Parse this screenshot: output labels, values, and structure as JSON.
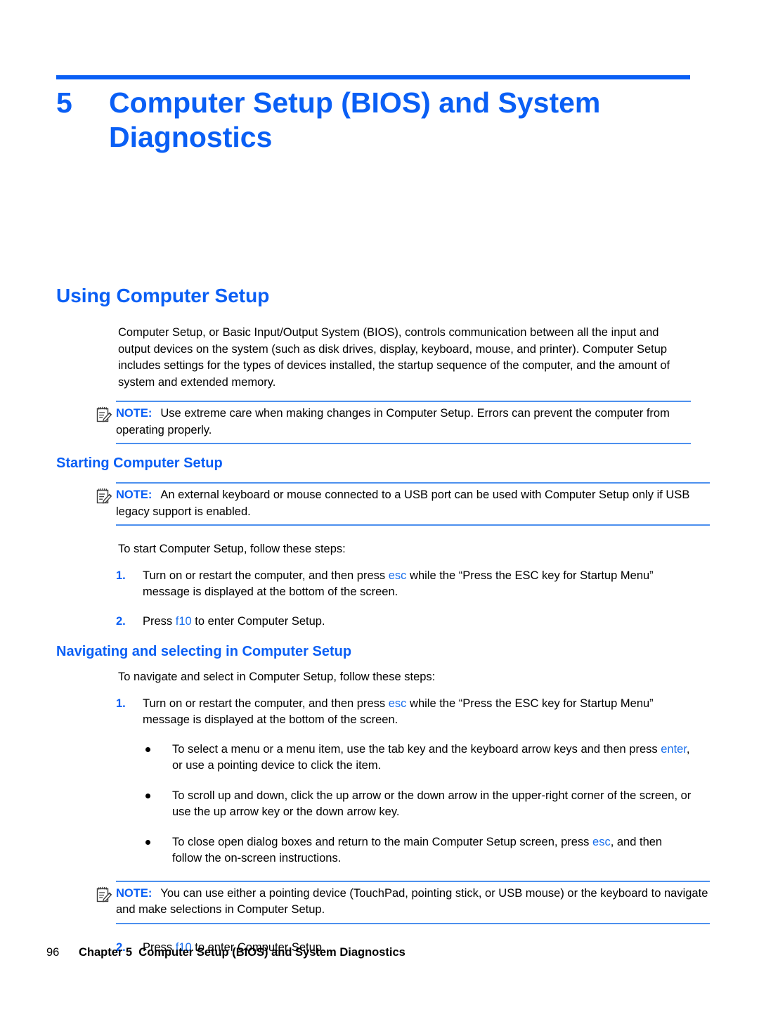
{
  "colors": {
    "accent_blue": "#0a5ff5",
    "keyword_blue": "#1a6fec",
    "note_rule": "#4d90ee",
    "text": "#000000"
  },
  "chapter": {
    "number": "5",
    "title": "Computer Setup (BIOS) and System Diagnostics"
  },
  "sections": {
    "using": {
      "heading": "Using Computer Setup",
      "paragraph": "Computer Setup, or Basic Input/Output System (BIOS), controls communication between all the input and output devices on the system (such as disk drives, display, keyboard, mouse, and printer). Computer Setup includes settings for the types of devices installed, the startup sequence of the computer, and the amount of system and extended memory.",
      "note": {
        "label": "NOTE:",
        "icon": "note-pencil-icon",
        "text": "Use extreme care when making changes in Computer Setup. Errors can prevent the computer from operating properly."
      }
    },
    "starting": {
      "heading": "Starting Computer Setup",
      "note": {
        "label": "NOTE:",
        "icon": "note-pencil-icon",
        "text": "An external keyboard or mouse connected to a USB port can be used with Computer Setup only if USB legacy support is enabled."
      },
      "intro": "To start Computer Setup, follow these steps:",
      "steps": [
        {
          "number": "1.",
          "parts": [
            {
              "t": "Turn on or restart the computer, and then press "
            },
            {
              "t": "esc",
              "kw": true
            },
            {
              "t": " while the “Press the ESC key for Startup Menu” message is displayed at the bottom of the screen."
            }
          ]
        },
        {
          "number": "2.",
          "parts": [
            {
              "t": "Press "
            },
            {
              "t": "f10",
              "kw": true
            },
            {
              "t": " to enter Computer Setup."
            }
          ]
        }
      ]
    },
    "navigating": {
      "heading": "Navigating and selecting in Computer Setup",
      "intro": "To navigate and select in Computer Setup, follow these steps:",
      "step1": {
        "number": "1.",
        "parts": [
          {
            "t": "Turn on or restart the computer, and then press "
          },
          {
            "t": "esc",
            "kw": true
          },
          {
            "t": " while the “Press the ESC key for Startup Menu” message is displayed at the bottom of the screen."
          }
        ]
      },
      "bullets": [
        {
          "parts": [
            {
              "t": "To select a menu or a menu item, use the tab key and the keyboard arrow keys and then press "
            },
            {
              "t": "enter",
              "kw": true
            },
            {
              "t": ", or use a pointing device to click the item."
            }
          ]
        },
        {
          "parts": [
            {
              "t": "To scroll up and down, click the up arrow or the down arrow in the upper-right corner of the screen, or use the up arrow key or the down arrow key."
            }
          ]
        },
        {
          "parts": [
            {
              "t": "To close open dialog boxes and return to the main Computer Setup screen, press "
            },
            {
              "t": "esc",
              "kw": true
            },
            {
              "t": ", and then follow the on-screen instructions."
            }
          ]
        }
      ],
      "note": {
        "label": "NOTE:",
        "icon": "note-pencil-icon",
        "text": "You can use either a pointing device (TouchPad, pointing stick, or USB mouse) or the keyboard to navigate and make selections in Computer Setup."
      },
      "step2": {
        "number": "2.",
        "parts": [
          {
            "t": "Press "
          },
          {
            "t": "f10",
            "kw": true
          },
          {
            "t": " to enter Computer Setup."
          }
        ]
      }
    }
  },
  "footer": {
    "page_number": "96",
    "chapter_label": "Chapter 5",
    "chapter_title": "Computer Setup (BIOS) and System Diagnostics"
  }
}
